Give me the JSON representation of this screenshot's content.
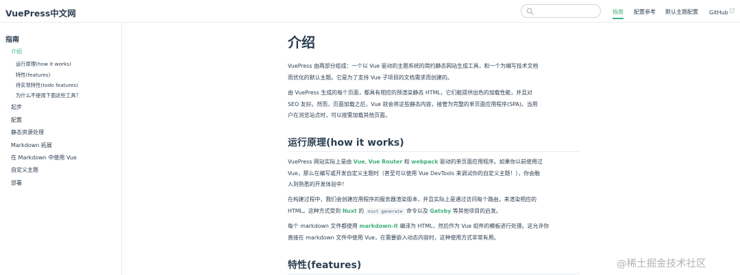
{
  "site": {
    "title": "VuePress中文网"
  },
  "search": {
    "placeholder": "",
    "value": ""
  },
  "nav": {
    "items": [
      {
        "label": "指南",
        "active": true
      },
      {
        "label": "配置参考"
      },
      {
        "label": "默认主题配置"
      },
      {
        "label": "GitHub",
        "external": true
      }
    ]
  },
  "sidebar": {
    "heading": "指南",
    "active": "介绍",
    "subitems": [
      "运行原理(how it works)",
      "特性(features)",
      "待实现特性(todo features)",
      "为什么不使用下面这些工具？"
    ],
    "items": [
      "起步",
      "配置",
      "静态资源处理",
      "Markdown 拓展",
      "在 Markdown 中使用 Vue",
      "自定义主题",
      "部署"
    ]
  },
  "content": {
    "title": "介绍",
    "p1": {
      "line1": "VuePress 由两部分组成：一个以 Vue 驱动的主题系统的简约静态网站生成工具，和一个为编写技术文档",
      "line2": "而优化的默认主题。它是为了支持 Vue 子项目的文档需求而创建的。"
    },
    "p2": {
      "line1": "由 VuePress 生成的每个页面，都具有相应的预渲染静态 HTML，它们能提供出色的加载性能，并且对",
      "line2": "SEO 友好。然而，页面加载之后，Vue 就会将这些静态内容，接管为完整的单页面应用程序(SPA)。当用",
      "line3": "户在浏览站点时，可以按需加载其他页面。"
    },
    "h2_how": "运行原理(how it works)",
    "p3": {
      "a": "VuePress 网站实际上是由 ",
      "vue": "Vue",
      "comma": ", ",
      "router": "Vue Router",
      "and": " 和 ",
      "webpack": "webpack",
      "b": " 驱动的单页面应用程序。如果你以前使用过",
      "line2": "Vue，那么在编写或开发自定义主题时（甚至可以使用 Vue DevTools 来调试你的自定义主题！），你会融",
      "line3": "入到熟悉的开发体验中！"
    },
    "p4": {
      "line1": "在构建过程中，我们会创建应用程序的服务器渲染版本，并且实际上是通过访问每个路由，来渲染相应的",
      "a": "HTML。这种方式受到 ",
      "nuxt": "Nuxt",
      "b": " 的 ",
      "code": "nuxt generate",
      "c": " 命令以及 ",
      "gatsby": "Gatsby",
      "d": " 等其他项目的启发。"
    },
    "p5": {
      "a": "每个 markdown 文件都使用 ",
      "mdit": "markdown-it",
      "b": " 编译为 HTML，然后作为 Vue 组件的模板进行处理。这允许你",
      "line2": "直接在 markdown 文件中使用 Vue，在需要嵌入动态内容时，这种使用方式非常有用。"
    },
    "h2_features": "特性(features)"
  },
  "watermark": "@稀土掘金技术社区",
  "colors": {
    "accent": "#3eaf7c",
    "text": "#2c3e50",
    "border": "#eaecef"
  }
}
